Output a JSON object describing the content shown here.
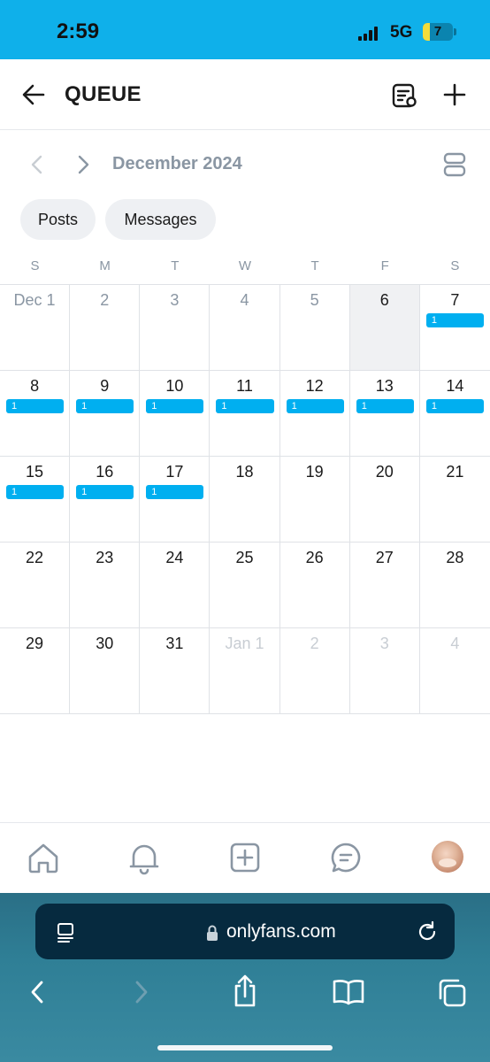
{
  "status_bar": {
    "time": "2:59",
    "network": "5G",
    "battery": "7",
    "battery_level": 0.07
  },
  "header": {
    "title": "QUEUE",
    "back_icon": "arrow-left-icon",
    "list_icon": "queue-list-icon",
    "add_icon": "plus-icon"
  },
  "calendar_nav": {
    "month": "December 2024",
    "prev_icon": "chevron-left-icon",
    "next_icon": "chevron-right-icon",
    "view_icon": "calendar-view-icon"
  },
  "filters": {
    "posts_label": "Posts",
    "messages_label": "Messages"
  },
  "weekdays": [
    "S",
    "M",
    "T",
    "W",
    "T",
    "F",
    "S"
  ],
  "weeks": [
    [
      {
        "label": "Dec 1",
        "style": "muted"
      },
      {
        "label": "2",
        "style": "muted"
      },
      {
        "label": "3",
        "style": "muted"
      },
      {
        "label": "4",
        "style": "muted"
      },
      {
        "label": "5",
        "style": "muted"
      },
      {
        "label": "6",
        "style": "today",
        "highlight": true
      },
      {
        "label": "7",
        "count": "1"
      }
    ],
    [
      {
        "label": "8",
        "count": "1"
      },
      {
        "label": "9",
        "count": "1"
      },
      {
        "label": "10",
        "count": "1"
      },
      {
        "label": "11",
        "count": "1"
      },
      {
        "label": "12",
        "count": "1"
      },
      {
        "label": "13",
        "count": "1"
      },
      {
        "label": "14",
        "count": "1"
      }
    ],
    [
      {
        "label": "15",
        "count": "1"
      },
      {
        "label": "16",
        "count": "1"
      },
      {
        "label": "17",
        "count": "1"
      },
      {
        "label": "18"
      },
      {
        "label": "19"
      },
      {
        "label": "20"
      },
      {
        "label": "21"
      }
    ],
    [
      {
        "label": "22"
      },
      {
        "label": "23"
      },
      {
        "label": "24"
      },
      {
        "label": "25"
      },
      {
        "label": "26"
      },
      {
        "label": "27"
      },
      {
        "label": "28"
      }
    ],
    [
      {
        "label": "29"
      },
      {
        "label": "30"
      },
      {
        "label": "31"
      },
      {
        "label": "Jan 1",
        "style": "faint"
      },
      {
        "label": "2",
        "style": "faint"
      },
      {
        "label": "3",
        "style": "faint"
      },
      {
        "label": "4",
        "style": "faint"
      }
    ]
  ],
  "bottom_nav": {
    "items": [
      "home-icon",
      "bell-icon",
      "add-post-icon",
      "messages-icon",
      "avatar"
    ]
  },
  "browser": {
    "url": "onlyfans.com",
    "icons": [
      "reader-icon",
      "lock-icon",
      "reload-icon",
      "back-icon",
      "forward-icon",
      "share-icon",
      "bookmarks-icon",
      "tabs-icon"
    ]
  },
  "colors": {
    "status_bar": "#0fb0ea",
    "accent": "#00aff0",
    "muted_text": "#8a96a3"
  }
}
